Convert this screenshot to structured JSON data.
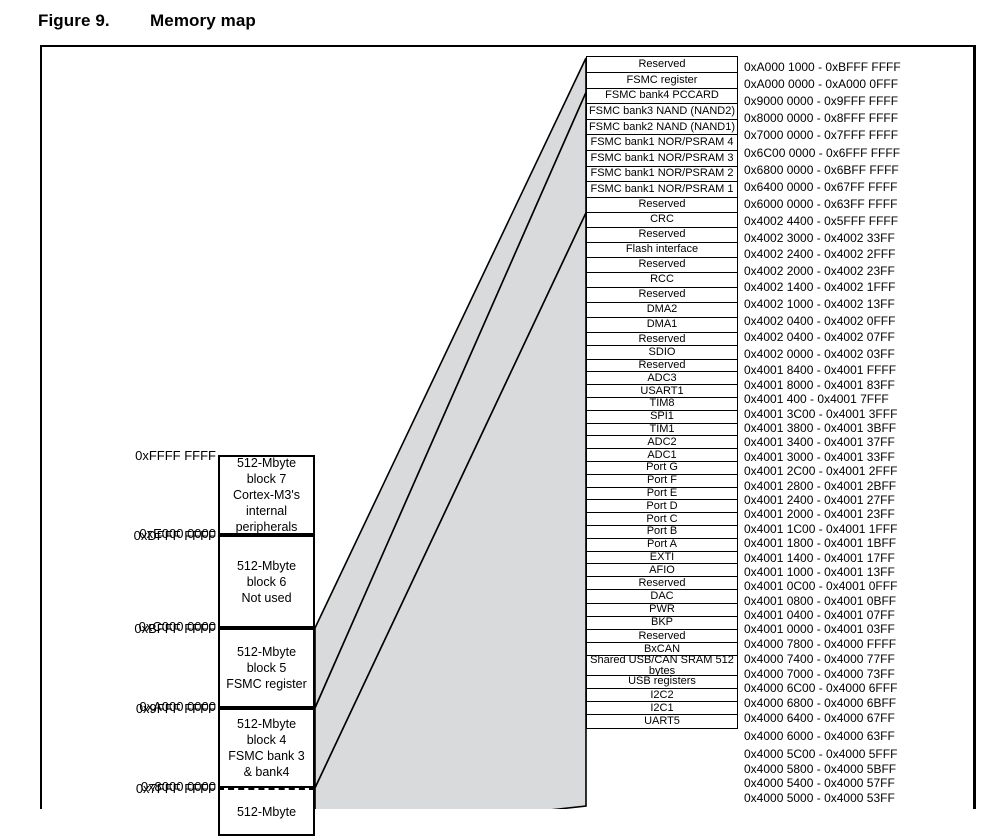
{
  "figure": {
    "number": "Figure 9.",
    "title": "Memory map"
  },
  "blocks": [
    {
      "lines": [
        "512-Mbyte",
        "block 7",
        "Cortex-M3's",
        "internal",
        "peripherals"
      ],
      "top_addr": "0xFFFF FFFF",
      "bottom_addr": "0xE000 0000",
      "dashed_top": false
    },
    {
      "lines": [
        "512-Mbyte",
        "block 6",
        "Not used"
      ],
      "top_addr": "0xDFFF FFFF",
      "bottom_addr": "0xC000 0000",
      "dashed_top": false
    },
    {
      "lines": [
        "512-Mbyte",
        "block 5",
        "FSMC register"
      ],
      "top_addr": "0xBFFF FFFF",
      "bottom_addr": "0xA000 0000",
      "dashed_top": false
    },
    {
      "lines": [
        "512-Mbyte",
        "block 4",
        "FSMC bank 3",
        "& bank4"
      ],
      "top_addr": "0x9FFF FFFF",
      "bottom_addr": "0x8000 0000",
      "dashed_top": false
    },
    {
      "lines": [
        "512-Mbyte"
      ],
      "top_addr": "0x7FFF FFFF",
      "bottom_addr": "",
      "dashed_top": true
    }
  ],
  "table": {
    "rows": [
      {
        "label": "Reserved",
        "address": "0xA000 1000 - 0xBFFF FFFF"
      },
      {
        "label": "FSMC register",
        "address": "0xA000 0000 - 0xA000 0FFF"
      },
      {
        "label": "FSMC bank4 PCCARD",
        "address": "0x9000 0000 - 0x9FFF FFFF"
      },
      {
        "label": "FSMC bank3 NAND (NAND2)",
        "address": "0x8000 0000 - 0x8FFF FFFF"
      },
      {
        "label": "FSMC bank2 NAND (NAND1)",
        "address": "0x7000 0000 - 0x7FFF FFFF"
      },
      {
        "label": "FSMC bank1 NOR/PSRAM 4",
        "address": "0x6C00 0000 - 0x6FFF FFFF"
      },
      {
        "label": "FSMC bank1 NOR/PSRAM 3",
        "address": "0x6800 0000 - 0x6BFF FFFF"
      },
      {
        "label": "FSMC bank1 NOR/PSRAM 2",
        "address": "0x6400 0000 - 0x67FF FFFF"
      },
      {
        "label": "FSMC bank1 NOR/PSRAM 1",
        "address": "0x6000 0000 - 0x63FF FFFF"
      },
      {
        "label": "Reserved",
        "address": "0x4002 4400 - 0x5FFF FFFF"
      },
      {
        "label": "CRC",
        "address": "0x4002 3000 - 0x4002 33FF"
      },
      {
        "label": "Reserved",
        "address": "0x4002 2400 - 0x4002 2FFF"
      },
      {
        "label": "Flash interface",
        "address": "0x4002 2000 - 0x4002 23FF"
      },
      {
        "label": "Reserved",
        "address": "0x4002 1400 - 0x4002 1FFF"
      },
      {
        "label": "RCC",
        "address": "0x4002 1000 - 0x4002 13FF"
      },
      {
        "label": "Reserved",
        "address": "0x4002 0400 - 0x4002 0FFF"
      },
      {
        "label": "DMA2",
        "address": "0x4002 0400 - 0x4002 07FF"
      },
      {
        "label": "DMA1",
        "address": "0x4002 0000 - 0x4002 03FF"
      },
      {
        "label": "Reserved",
        "address": "0x4001 8400 - 0x4001 FFFF"
      },
      {
        "label": "SDIO",
        "address": "0x4001 8000 - 0x4001 83FF"
      },
      {
        "label": "Reserved",
        "address": "0x4001 400 - 0x4001 7FFF"
      },
      {
        "label": "ADC3",
        "address": "0x4001 3C00 - 0x4001 3FFF"
      },
      {
        "label": "USART1",
        "address": "0x4001 3800 - 0x4001 3BFF"
      },
      {
        "label": "TIM8",
        "address": "0x4001 3400 - 0x4001 37FF"
      },
      {
        "label": "SPI1",
        "address": "0x4001 3000 - 0x4001 33FF"
      },
      {
        "label": "TIM1",
        "address": "0x4001 2C00 - 0x4001 2FFF"
      },
      {
        "label": "ADC2",
        "address": "0x4001 2800 - 0x4001 2BFF"
      },
      {
        "label": "ADC1",
        "address": "0x4001 2400 - 0x4001 27FF"
      },
      {
        "label": "Port G",
        "address": "0x4001 2000 - 0x4001 23FF"
      },
      {
        "label": "Port F",
        "address": "0x4001 1C00 - 0x4001 1FFF"
      },
      {
        "label": "Port E",
        "address": "0x4001 1800 - 0x4001 1BFF"
      },
      {
        "label": "Port D",
        "address": "0x4001 1400 - 0x4001 17FF"
      },
      {
        "label": "Port C",
        "address": "0x4001 1000 - 0x4001 13FF"
      },
      {
        "label": "Port B",
        "address": "0x4001 0C00 - 0x4001 0FFF"
      },
      {
        "label": "Port A",
        "address": "0x4001 0800 - 0x4001 0BFF"
      },
      {
        "label": "EXTI",
        "address": "0x4001 0400 - 0x4001 07FF"
      },
      {
        "label": "AFIO",
        "address": "0x4001 0000 - 0x4001 03FF"
      },
      {
        "label": "Reserved",
        "address": "0x4000 7800 - 0x4000 FFFF"
      },
      {
        "label": "DAC",
        "address": "0x4000 7400 - 0x4000 77FF"
      },
      {
        "label": "PWR",
        "address": "0x4000 7000 - 0x4000 73FF"
      },
      {
        "label": "BKP",
        "address": "0x4000 6C00 - 0x4000 6FFF"
      },
      {
        "label": "Reserved",
        "address": "0x4000 6800 - 0x4000 6BFF"
      },
      {
        "label": "BxCAN",
        "address": "0x4000 6400 - 0x4000 67FF"
      },
      {
        "label": "Shared USB/CAN SRAM 512 bytes",
        "address": "0x4000 6000 - 0x4000 63FF"
      },
      {
        "label": "USB registers",
        "address": "0x4000 5C00 - 0x4000 5FFF"
      },
      {
        "label": "I2C2",
        "address": "0x4000 5800 - 0x4000 5BFF"
      },
      {
        "label": "I2C1",
        "address": "0x4000 5400 - 0x4000 57FF"
      },
      {
        "label": "UART5",
        "address": "0x4000 5000 - 0x4000 53FF"
      }
    ]
  },
  "colors": {
    "connector_fill": "#d9dadb",
    "line": "#000000"
  }
}
